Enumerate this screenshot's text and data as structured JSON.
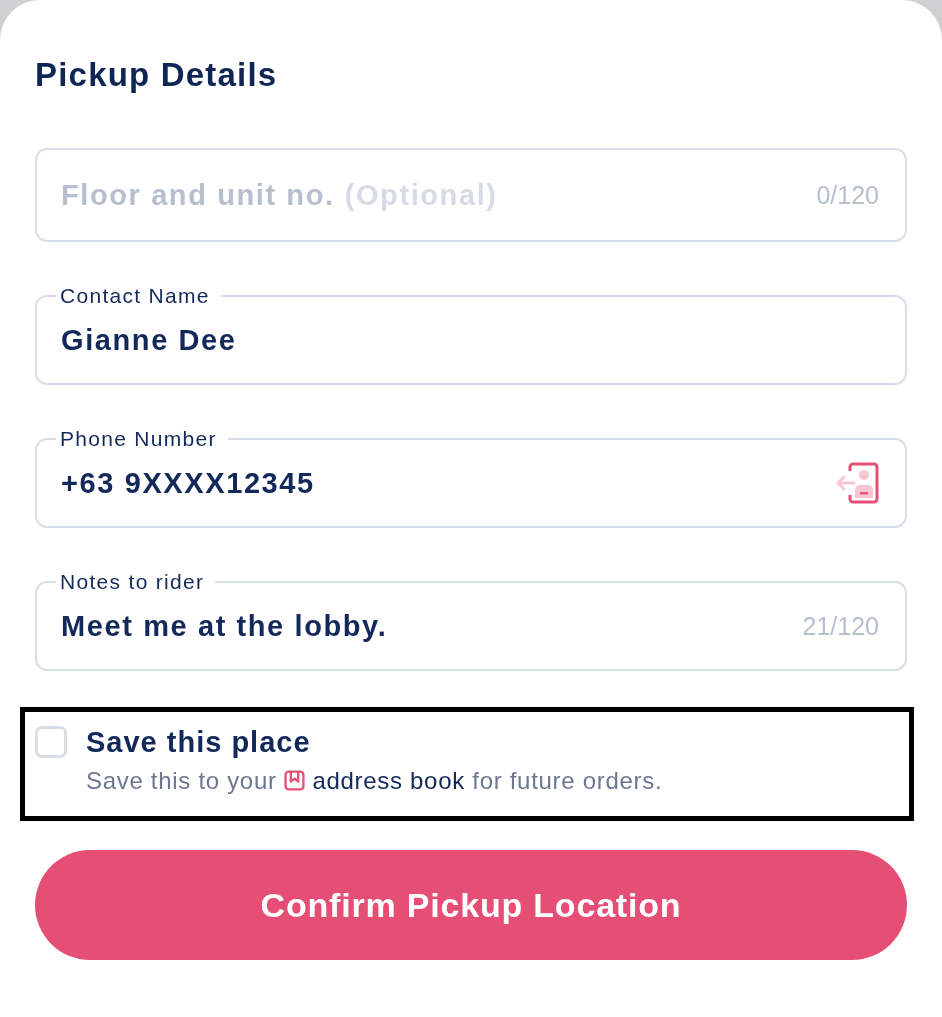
{
  "heading": "Pickup Details",
  "fields": [
    {
      "kind": "text",
      "placeholder": "Floor and unit no.",
      "placeholder_note": "(Optional)",
      "counter": "0/120"
    },
    {
      "kind": "text",
      "label": "Contact Name",
      "value": "Gianne Dee"
    },
    {
      "kind": "phone",
      "label": "Phone Number",
      "value": "+63 9XXXX12345"
    },
    {
      "kind": "text",
      "label": "Notes to rider",
      "value": "Meet me at the lobby.",
      "counter": "21/120"
    }
  ],
  "save_place": {
    "highlighted": true,
    "checked": false,
    "title": "Save this place",
    "description_before": "Save this to your",
    "link": "address book",
    "description_after": "for future orders."
  },
  "confirm_button": "Confirm Pickup Location"
}
